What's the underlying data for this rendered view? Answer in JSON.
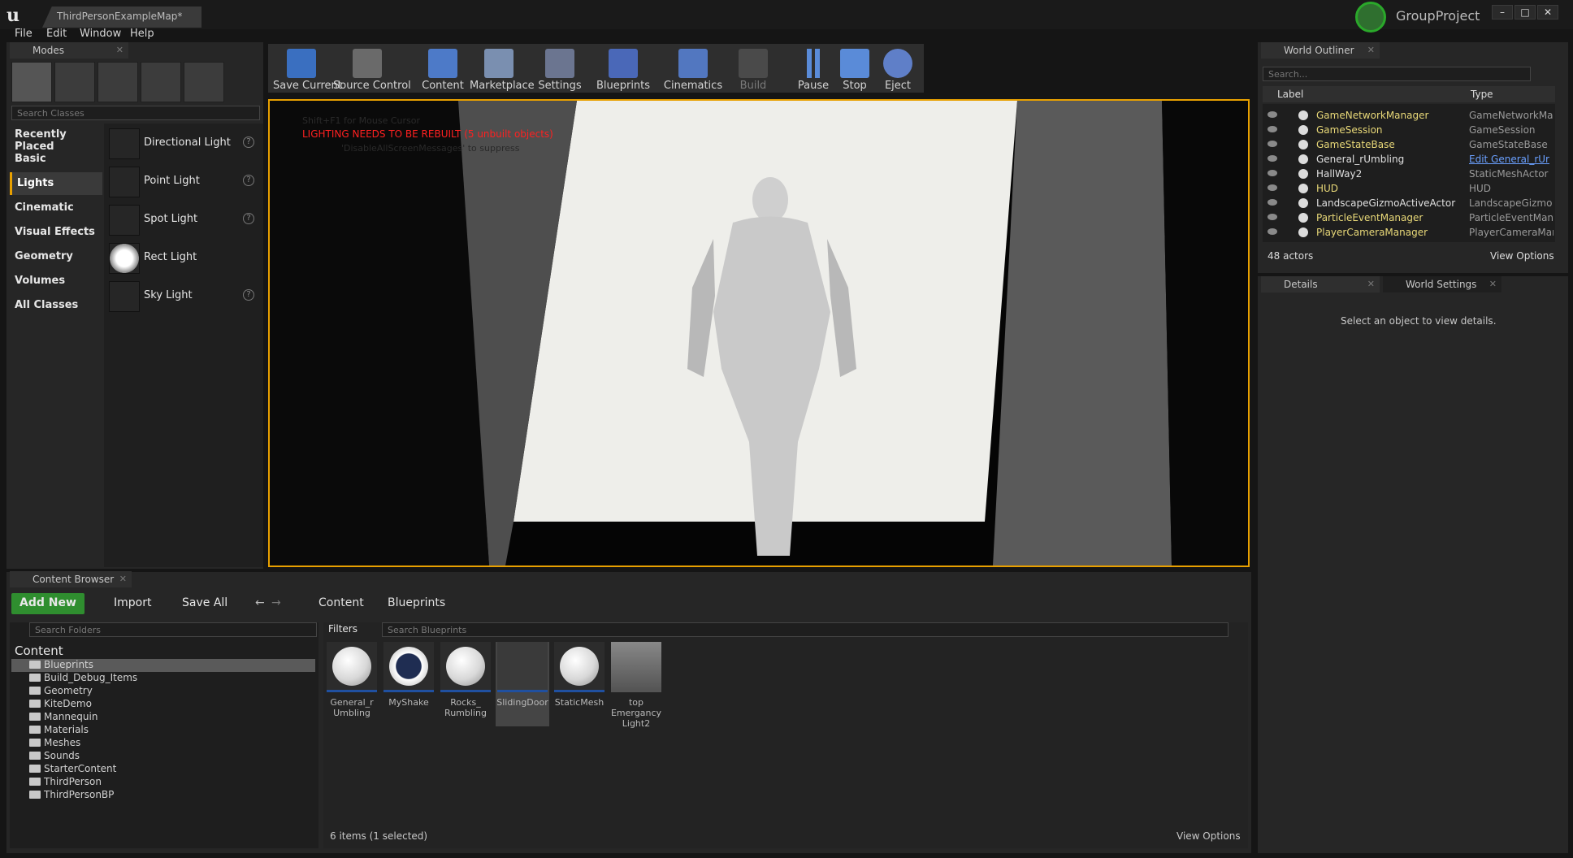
{
  "window": {
    "map_tab": "ThirdPersonExampleMap*",
    "project": "GroupProject",
    "buttons": [
      "–",
      "□",
      "✕"
    ]
  },
  "menu": [
    "File",
    "Edit",
    "Window",
    "Help"
  ],
  "modes": {
    "tab": "Modes",
    "search_placeholder": "Search Classes",
    "categories": [
      "Recently Placed",
      "Basic",
      "Lights",
      "Cinematic",
      "Visual Effects",
      "Geometry",
      "Volumes",
      "All Classes"
    ],
    "selected": "Lights",
    "lights": [
      "Directional Light",
      "Point Light",
      "Spot Light",
      "Rect Light",
      "Sky Light"
    ],
    "help": "?"
  },
  "toolbar": {
    "buttons": [
      "Save Current",
      "Source Control",
      "Content",
      "Marketplace",
      "Settings",
      "Blueprints",
      "Cinematics",
      "Build",
      "Pause",
      "Stop",
      "Eject"
    ]
  },
  "viewport": {
    "hint": "Shift+F1 for Mouse Cursor",
    "warning": "LIGHTING NEEDS TO BE REBUILT (5 unbuilt objects)",
    "hint2": "'DisableAllScreenMessages' to suppress"
  },
  "content_browser": {
    "tab": "Content Browser",
    "add_new": "Add New",
    "import": "Import",
    "save_all": "Save All",
    "crumbs": [
      "Content",
      "Blueprints"
    ],
    "folder_search": "Search Folders",
    "filters": "Filters",
    "asset_search": "Search Blueprints",
    "root": "Content",
    "folders": [
      "Blueprints",
      "Build_Debug_Items",
      "Geometry",
      "KiteDemo",
      "Mannequin",
      "Materials",
      "Meshes",
      "Sounds",
      "StarterContent",
      "ThirdPerson",
      "ThirdPersonBP"
    ],
    "assets": [
      {
        "name": "General_r Umbling"
      },
      {
        "name": "MyShake"
      },
      {
        "name": "Rocks_ Rumbling"
      },
      {
        "name": "SlidingDoor"
      },
      {
        "name": "StaticMesh"
      },
      {
        "name": "top Emergancy Light2"
      }
    ],
    "status": "6 items (1 selected)",
    "view_options": "View Options"
  },
  "outliner": {
    "tab": "World Outliner",
    "search_placeholder": "Search...",
    "col_label": "Label",
    "col_type": "Type",
    "rows": [
      {
        "label": "GameNetworkManager",
        "type": "GameNetworkMan"
      },
      {
        "label": "GameSession",
        "type": "GameSession"
      },
      {
        "label": "GameStateBase",
        "type": "GameStateBase"
      },
      {
        "label": "General_rUmbling",
        "type": "Edit General_rUr"
      },
      {
        "label": "HallWay2",
        "type": "StaticMeshActor"
      },
      {
        "label": "HUD",
        "type": "HUD"
      },
      {
        "label": "LandscapeGizmoActiveActor",
        "type": "LandscapeGizmo"
      },
      {
        "label": "ParticleEventManager",
        "type": "ParticleEventMan"
      },
      {
        "label": "PlayerCameraManager",
        "type": "PlayerCameraMar"
      }
    ],
    "count": "48 actors",
    "view_options": "View Options"
  },
  "details": {
    "tab": "Details",
    "tab2": "World Settings",
    "empty": "Select an object to view details."
  },
  "colors": {
    "accent": "#e8a000",
    "warning": "#ff2020",
    "green": "#2f8e2f",
    "link": "#6aa0ff"
  }
}
